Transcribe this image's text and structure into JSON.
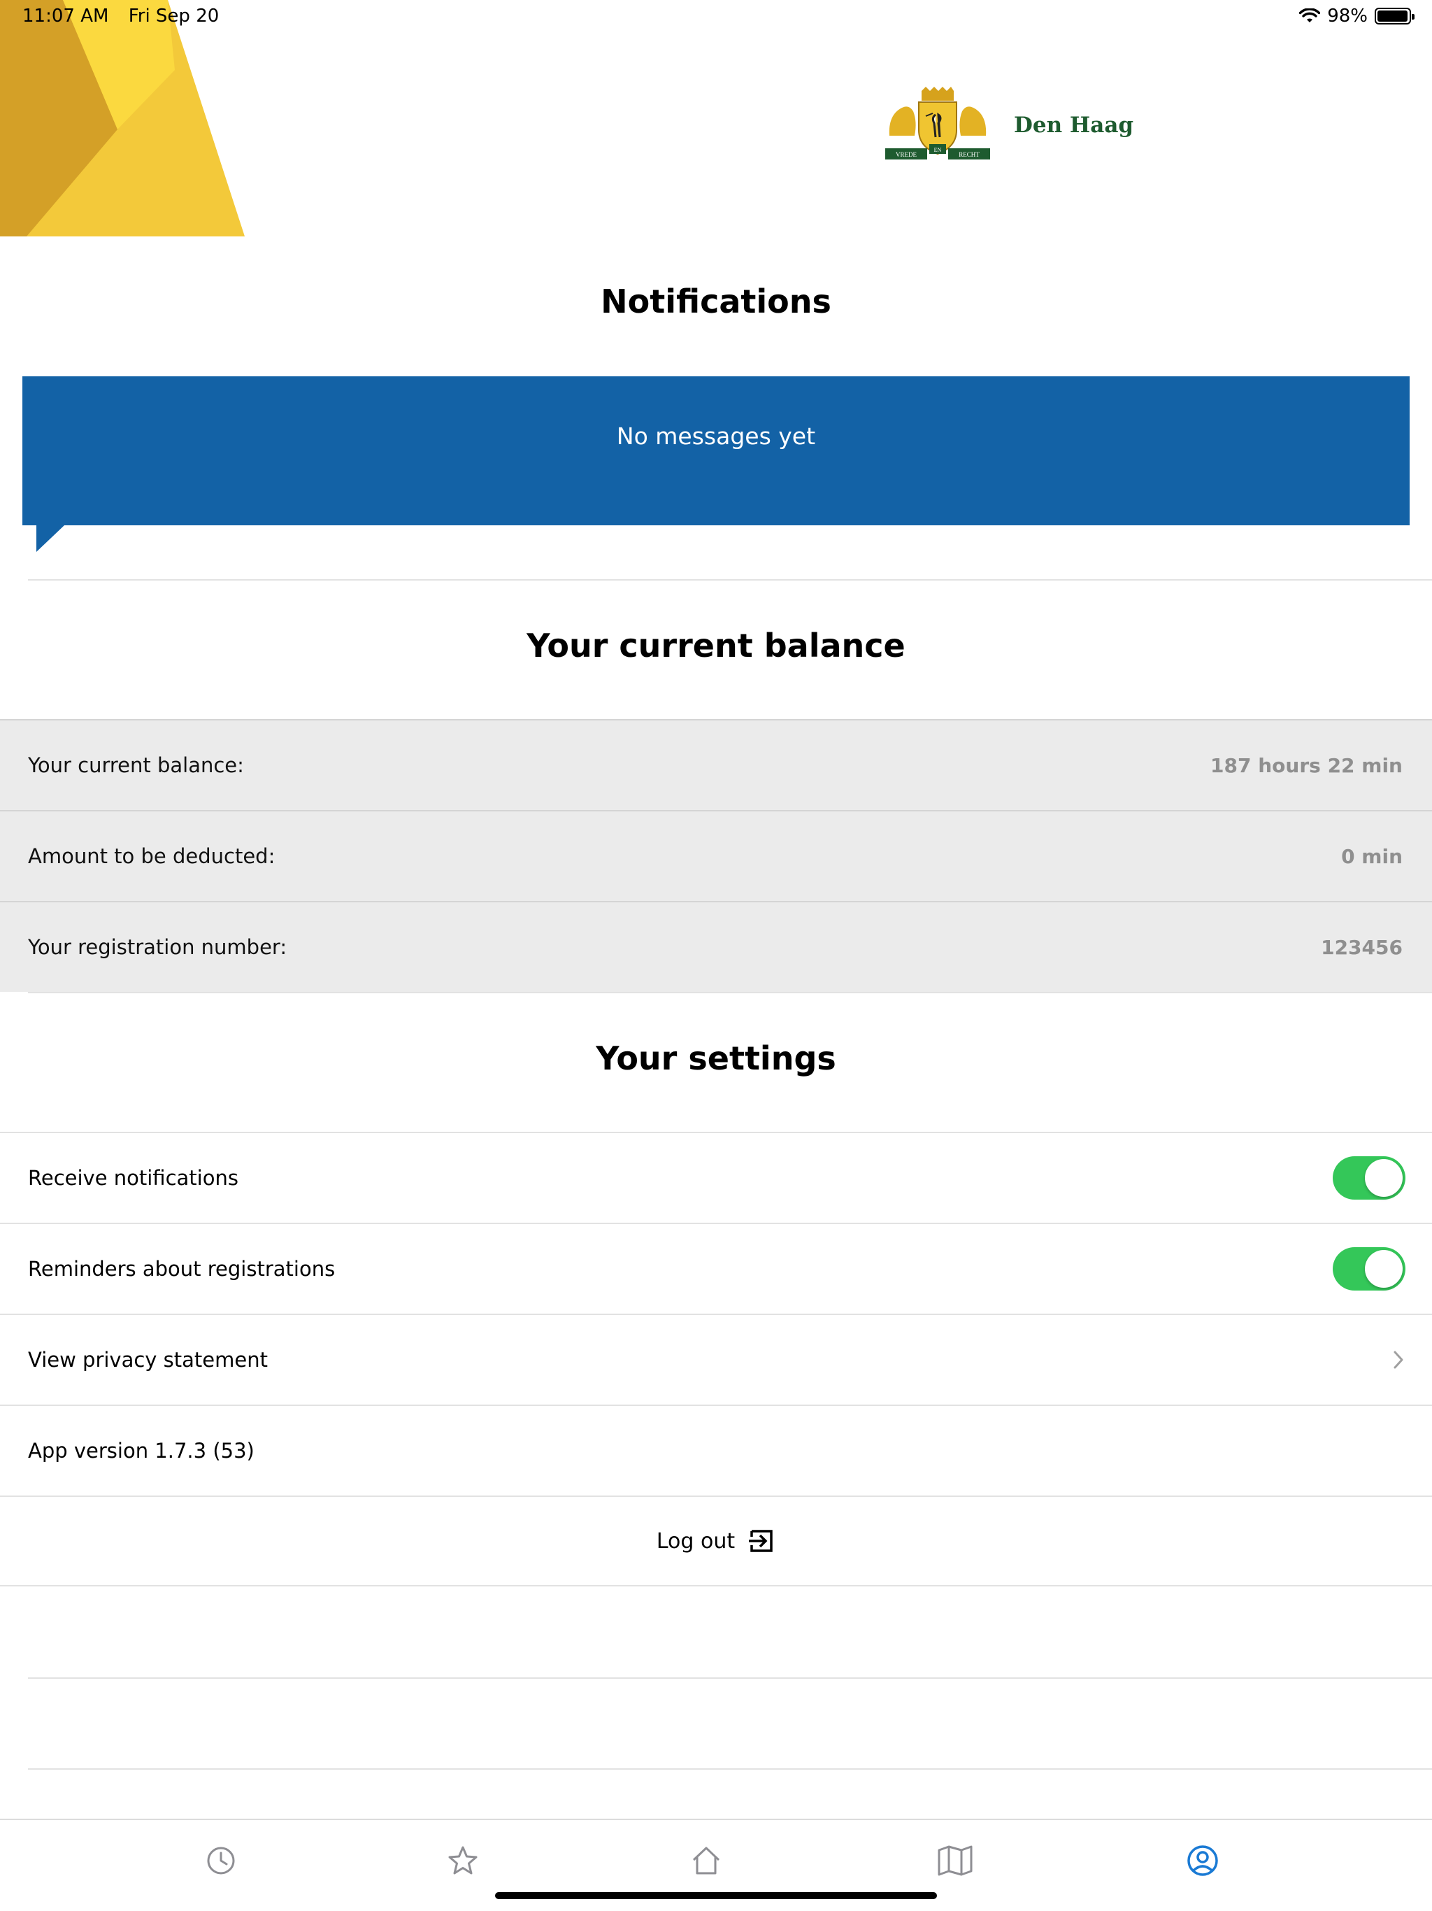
{
  "status_bar": {
    "time": "11:07 AM",
    "date": "Fri Sep 20",
    "battery": "98%",
    "battery_level": 0.98
  },
  "header": {
    "logo_name": "Den Haag",
    "logo_icon": "den-haag-coat-of-arms-icon",
    "logo_motto": [
      "VREDE",
      "EN",
      "RECHT"
    ]
  },
  "notifications": {
    "title": "Notifications",
    "empty_message": "No messages yet"
  },
  "balance": {
    "title": "Your current balance",
    "rows": [
      {
        "label": "Your current balance:",
        "value": "187 hours 22 min"
      },
      {
        "label": "Amount to be deducted:",
        "value": "0 min"
      },
      {
        "label": "Your registration number:",
        "value": "123456"
      }
    ]
  },
  "settings": {
    "title": "Your settings",
    "receive_notifications": {
      "label": "Receive notifications",
      "enabled": true
    },
    "reminders": {
      "label": "Reminders about registrations",
      "enabled": true
    },
    "privacy": {
      "label": "View privacy statement",
      "icon": "chevron-right-icon"
    },
    "app_version": "App version 1.7.3 (53)",
    "logout": {
      "label": "Log out",
      "icon": "logout-icon"
    }
  },
  "tab_bar": {
    "items": [
      {
        "icon": "clock-icon",
        "active": false
      },
      {
        "icon": "star-icon",
        "active": false
      },
      {
        "icon": "home-icon",
        "active": false
      },
      {
        "icon": "map-icon",
        "active": false
      },
      {
        "icon": "user-profile-icon",
        "active": true
      }
    ]
  },
  "colors": {
    "banner_blue": "#1362a6",
    "toggle_green": "#34c759",
    "active_tab": "#1a7ad4",
    "inactive_tab": "#8e8e93",
    "brand_green": "#1e5b2f",
    "deco_yellow": "#f5c93a",
    "deco_ochre": "#d4a027"
  }
}
